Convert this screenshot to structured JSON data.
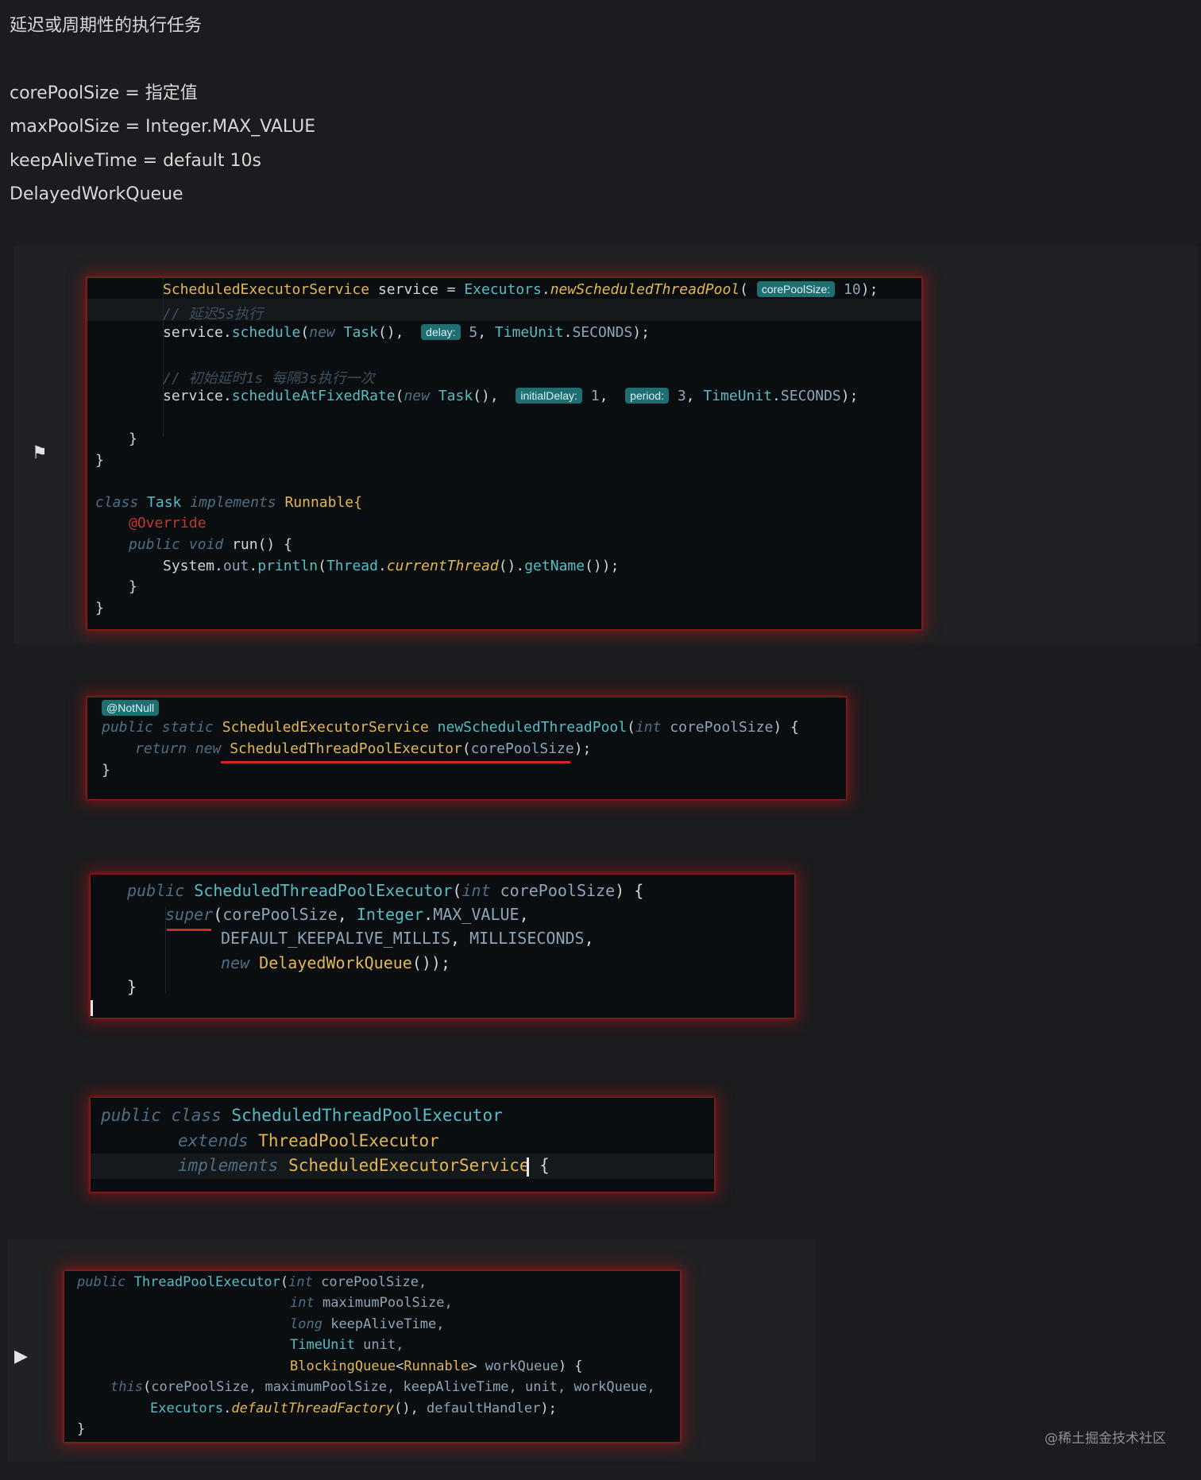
{
  "intro": {
    "title": "延迟或周期性的执行任务",
    "lines": [
      "corePoolSize = 指定值",
      "maxPoolSize = Integer.MAX_VALUE",
      "keepAliveTime = default 10s",
      "DelayedWorkQueue"
    ]
  },
  "snippet1": {
    "service_type": "ScheduledExecutorService",
    "service_var": "service",
    "executors": "Executors",
    "factory_method": "newScheduledThreadPool",
    "hint_core": "corePoolSize:",
    "core_value": "10",
    "comment_delay": "// 延迟5s执行",
    "schedule_call": "schedule",
    "new_kw": "new",
    "task_cls": "Task",
    "hint_delay": "delay:",
    "delay_value": "5",
    "timeunit": "TimeUnit",
    "seconds": "SECONDS",
    "comment_fixed": "// 初始延时1s 每隔3s执行一次",
    "fixed_call": "scheduleAtFixedRate",
    "hint_initial": "initialDelay:",
    "initial_value": "1",
    "hint_period": "period:",
    "period_value": "3",
    "class_kw": "class",
    "implements_kw": "implements",
    "runnable": "Runnable{",
    "override": "@Override",
    "public_void": "public void",
    "run_sig": "run() {",
    "system": "System",
    "out": "out",
    "println": "println",
    "thread": "Thread",
    "current_thread": "currentThread",
    "get_name": "getName"
  },
  "snippet2": {
    "notnull": "@NotNull",
    "public_static": "public static",
    "ret_type": "ScheduledExecutorService",
    "method": "newScheduledThreadPool",
    "param_type": "int",
    "param": "corePoolSize",
    "return_new": "return new",
    "ctor_call": "ScheduledThreadPoolExecutor",
    "arg": "corePoolSize"
  },
  "snippet3": {
    "public": "public",
    "ctor": "ScheduledThreadPoolExecutor",
    "int": "int",
    "param": "corePoolSize",
    "super": "super",
    "arg1": "corePoolSize",
    "integer": "Integer",
    "max_value": "MAX_VALUE",
    "keepalive": "DEFAULT_KEEPALIVE_MILLIS",
    "ms": "MILLISECONDS",
    "new": "new",
    "dwq": "DelayedWorkQueue"
  },
  "snippet4": {
    "public_class": "public class",
    "cls": "ScheduledThreadPoolExecutor",
    "extends": "extends",
    "parent": "ThreadPoolExecutor",
    "implements": "implements",
    "iface": "ScheduledExecutorService"
  },
  "snippet5": {
    "public": "public",
    "ctor": "ThreadPoolExecutor",
    "int": "int",
    "long": "long",
    "p_core": "corePoolSize,",
    "p_max": "maximumPoolSize,",
    "p_keep": "keepAliveTime,",
    "timeunit": "TimeUnit",
    "p_unit": "unit,",
    "blocking": "BlockingQueue",
    "runnable": "Runnable",
    "p_queue": "workQueue",
    "this": "this",
    "this_args": "corePoolSize, maximumPoolSize, keepAliveTime, unit, workQueue,",
    "executors": "Executors",
    "dtf": "defaultThreadFactory",
    "handler": "defaultHandler"
  },
  "watermark": "@稀土掘金技术社区"
}
